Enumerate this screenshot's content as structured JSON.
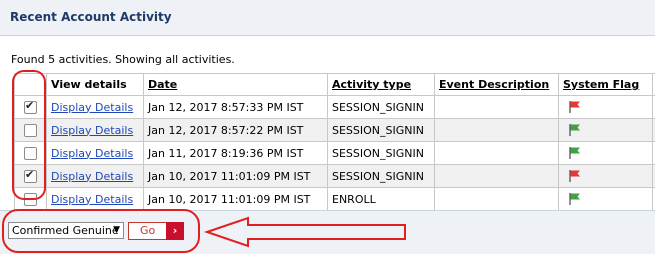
{
  "panel": {
    "title": "Recent Account Activity"
  },
  "summary": "Found 5 activities. Showing all activities.",
  "table": {
    "columns": [
      "",
      "View details",
      "Date",
      "Activity type",
      "Event Description",
      "System Flag"
    ],
    "rows": [
      {
        "checked": true,
        "link": "Display Details",
        "date": "Jan 12, 2017 8:57:33 PM IST",
        "activity": "SESSION_SIGNIN",
        "description": "",
        "flag": "red-flag-icon"
      },
      {
        "checked": false,
        "link": "Display Details",
        "date": "Jan 12, 2017 8:57:22 PM IST",
        "activity": "SESSION_SIGNIN",
        "description": "",
        "flag": "green-flag-icon"
      },
      {
        "checked": false,
        "link": "Display Details",
        "date": "Jan 11, 2017 8:19:36 PM IST",
        "activity": "SESSION_SIGNIN",
        "description": "",
        "flag": "green-flag-icon"
      },
      {
        "checked": true,
        "link": "Display Details",
        "date": "Jan 10, 2017 11:01:09 PM IST",
        "activity": "SESSION_SIGNIN",
        "description": "",
        "flag": "red-flag-icon"
      },
      {
        "checked": false,
        "link": "Display Details",
        "date": "Jan 10, 2017 11:01:09 PM IST",
        "activity": "ENROLL",
        "description": "",
        "flag": "green-flag-icon"
      }
    ]
  },
  "footer": {
    "select_value": "Confirmed Genuine",
    "go_label": "Go"
  },
  "colors": {
    "accent": "#c8102e",
    "annotation": "#e02020",
    "flag_red": "#e53935",
    "flag_green": "#43a047"
  }
}
